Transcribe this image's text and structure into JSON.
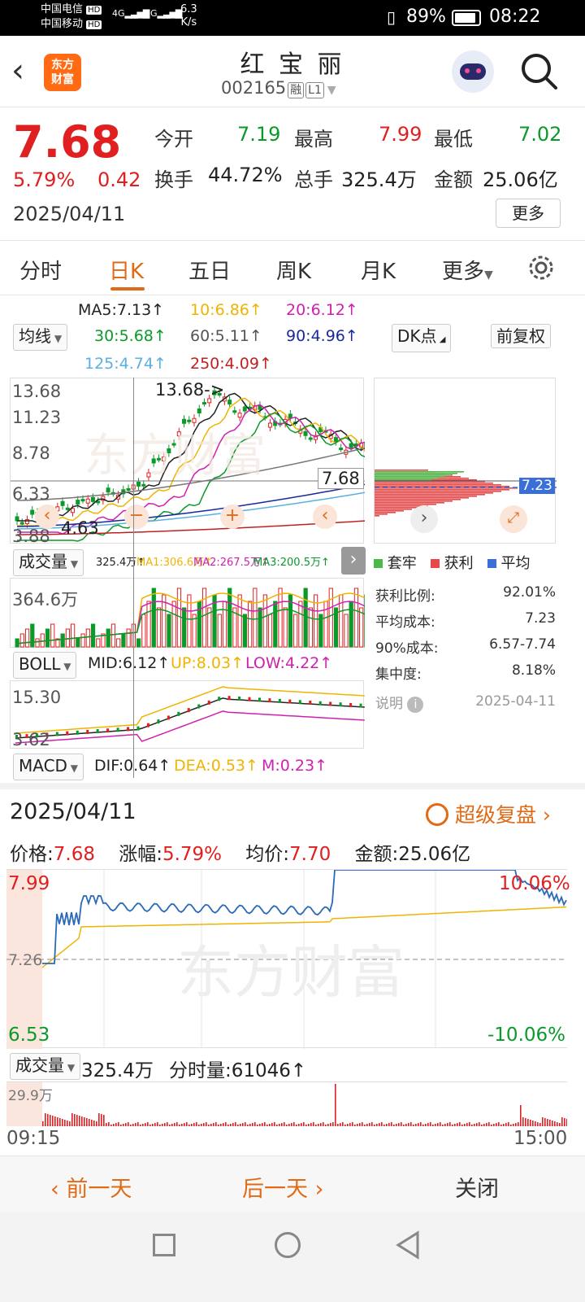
{
  "status": {
    "carrier1": "中国电信",
    "carrier2": "中国移动",
    "hd": "HD",
    "net1": "4G",
    "net2": "5G",
    "speed": "6.3",
    "speed_unit": "K/s",
    "battery": "89%",
    "time": "08:22"
  },
  "header": {
    "logo_line1": "东方",
    "logo_line2": "财富",
    "stock_name": "红 宝 丽",
    "stock_code": "002165",
    "badge1": "融",
    "badge2": "L1"
  },
  "quote": {
    "price": "7.68",
    "change_pct": "5.79%",
    "change": "0.42",
    "date": "2025/04/11",
    "open_label": "今开",
    "open": "7.19",
    "high_label": "最高",
    "high": "7.99",
    "low_label": "最低",
    "low": "7.02",
    "turnover_label": "换手",
    "turnover": "44.72%",
    "volume_label": "总手",
    "volume": "325.4万",
    "amount_label": "金额",
    "amount": "25.06亿",
    "more": "更多"
  },
  "tabs": [
    "分时",
    "日K",
    "五日",
    "周K",
    "月K",
    "更多"
  ],
  "ma": {
    "ma5": "MA5:7.13↑",
    "ma10": "10:6.86↑",
    "ma20": "20:6.12↑",
    "ma30": "30:5.68↑",
    "ma60": "60:5.11↑",
    "ma90": "90:4.96↑",
    "ma125": "125:4.74↑",
    "ma250": "250:4.09↑",
    "select": "均线",
    "dk": "DK点",
    "fq": "前复权"
  },
  "kline": {
    "y_top": "13.68",
    "y2": "11.23",
    "y3": "8.78",
    "y4": "6.33",
    "y5": "3.88",
    "peak_label": "13.68->",
    "low_label": "4.63",
    "cursor_price": "7.68"
  },
  "volume": {
    "select": "成交量",
    "legend": "325.4万↑",
    "ma1": "MA1:306.6万↑",
    "ma2": "MA2:267.5万↑",
    "ma3": "MA3:200.5万↑",
    "y_top": "364.6万"
  },
  "boll": {
    "select": "BOLL",
    "mid": "MID:6.12↑",
    "up": "UP:8.03↑",
    "low": "LOW:4.22↑",
    "y_top": "15.30",
    "y_bottom": "3.62"
  },
  "macd": {
    "select": "MACD",
    "dif": "DIF:0.64↑",
    "dea": "DEA:0.53↑",
    "m": "M:0.23↑"
  },
  "chip": {
    "price_tag": "7.23",
    "legend": [
      "套牢",
      "获利",
      "平均"
    ],
    "rows": [
      {
        "label": "获利比例:",
        "value": "92.01%"
      },
      {
        "label": "平均成本:",
        "value": "7.23"
      },
      {
        "label": "90%成本:",
        "value": "6.57-7.74"
      },
      {
        "label": "集中度:",
        "value": "8.18%"
      }
    ],
    "note_label": "说明",
    "note_date": "2025-04-11"
  },
  "intraday": {
    "date": "2025/04/11",
    "replay": "超级复盘",
    "price_label": "价格:",
    "price": "7.68",
    "pct_label": "涨幅:",
    "pct": "5.79%",
    "avg_label": "均价:",
    "avg": "7.70",
    "amount_label": "金额:",
    "amount": "25.06亿",
    "y_high": "7.99",
    "y_mid": "7.26",
    "y_low": "6.53",
    "pct_high": "10.06%",
    "pct_low": "-10.06%",
    "vol_select": "成交量",
    "vol_total": "325.4万",
    "vol_tick": "分时量:61046↑",
    "vol_max": "29.9万",
    "t_start": "09:15",
    "t_end": "15:00"
  },
  "bottom": {
    "prev": "前一天",
    "next": "后一天",
    "close": "关闭"
  },
  "watermark": "东方财富",
  "colors": {
    "red": "#e02020",
    "green": "#0a9a2a",
    "orange": "#e06a16",
    "ma5": "#222222",
    "ma10": "#f0b400",
    "ma20": "#d020b0",
    "ma30": "#0a9a2a",
    "ma60": "#777777",
    "ma90": "#1a2a9a",
    "ma125": "#5ab0e0",
    "ma250": "#c02020"
  }
}
